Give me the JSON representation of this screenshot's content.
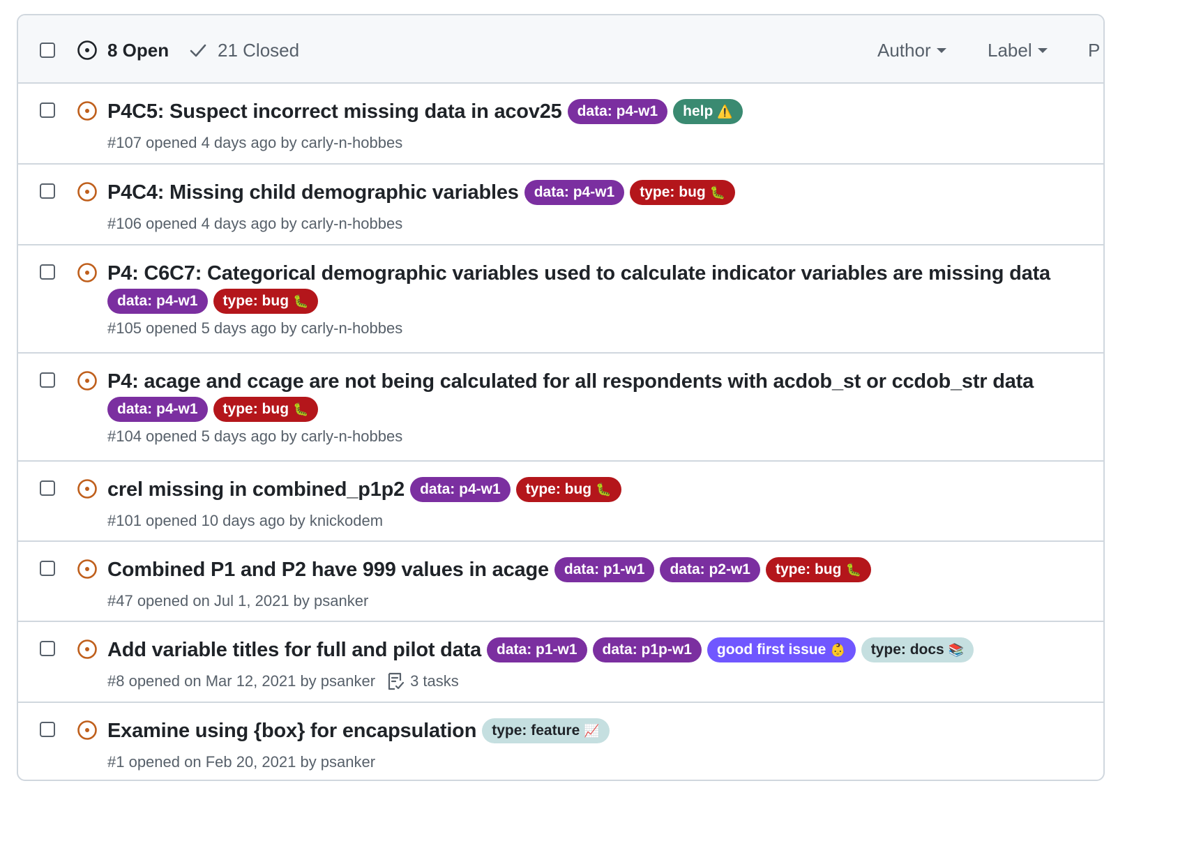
{
  "header": {
    "open_count": "8 Open",
    "closed_count": "21 Closed",
    "filters": [
      "Author",
      "Label",
      "P"
    ]
  },
  "colors": {
    "open_icon": "#bf5f1c",
    "label_data": "#7b2fa0",
    "label_bug": "#b4161b",
    "label_help": "#3a8a71",
    "label_good_first": "#7057ff",
    "label_pale": "#c5dfe0"
  },
  "issues": [
    {
      "title": "P4C5: Suspect incorrect missing data in acov25",
      "meta": "#107 opened 4 days ago by carly-n-hobbes",
      "labels": [
        {
          "text": "data: p4-w1",
          "emoji": ""
        },
        {
          "text": "help",
          "emoji": "⚠️"
        }
      ]
    },
    {
      "title": "P4C4: Missing child demographic variables",
      "meta": "#106 opened 4 days ago by carly-n-hobbes",
      "labels": [
        {
          "text": "data: p4-w1",
          "emoji": ""
        },
        {
          "text": "type: bug",
          "emoji": "🐛"
        }
      ]
    },
    {
      "title": "P4: C6C7: Categorical demographic variables used to calculate indicator variables are missing data",
      "meta": "#105 opened 5 days ago by carly-n-hobbes",
      "labels": [
        {
          "text": "data: p4-w1",
          "emoji": ""
        },
        {
          "text": "type: bug",
          "emoji": "🐛"
        }
      ]
    },
    {
      "title": "P4: acage and ccage are not being calculated for all respondents with acdob_st or ccdob_str data",
      "meta": "#104 opened 5 days ago by carly-n-hobbes",
      "labels": [
        {
          "text": "data: p4-w1",
          "emoji": ""
        },
        {
          "text": "type: bug",
          "emoji": "🐛"
        }
      ]
    },
    {
      "title": "crel missing in combined_p1p2",
      "meta": "#101 opened 10 days ago by knickodem",
      "labels": [
        {
          "text": "data: p4-w1",
          "emoji": ""
        },
        {
          "text": "type: bug",
          "emoji": "🐛"
        }
      ]
    },
    {
      "title": "Combined P1 and P2 have 999 values in acage",
      "meta": "#47 opened on Jul 1, 2021 by psanker",
      "labels": [
        {
          "text": "data: p1-w1",
          "emoji": ""
        },
        {
          "text": "data: p2-w1",
          "emoji": ""
        },
        {
          "text": "type: bug",
          "emoji": "🐛"
        }
      ]
    },
    {
      "title": "Add variable titles for full and pilot data",
      "meta": "#8 opened on Mar 12, 2021 by psanker",
      "tasks": "3 tasks",
      "labels": [
        {
          "text": "data: p1-w1",
          "emoji": ""
        },
        {
          "text": "data: p1p-w1",
          "emoji": ""
        },
        {
          "text": "good first issue",
          "emoji": "👶"
        },
        {
          "text": "type: docs",
          "emoji": "📚"
        }
      ]
    },
    {
      "title": "Examine using {box} for encapsulation",
      "meta": "#1 opened on Feb 20, 2021 by psanker",
      "labels": [
        {
          "text": "type: feature",
          "emoji": "📈"
        }
      ]
    }
  ]
}
